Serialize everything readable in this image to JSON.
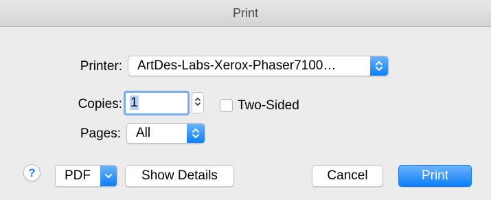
{
  "window": {
    "title": "Print"
  },
  "printer": {
    "label": "Printer:",
    "value": "ArtDes-Labs-Xerox-Phaser7100…"
  },
  "copies": {
    "label": "Copies:",
    "value": "1"
  },
  "two_sided": {
    "label": "Two-Sided",
    "checked": false
  },
  "pages": {
    "label": "Pages:",
    "value": "All"
  },
  "footer": {
    "help_label": "?",
    "pdf_label": "PDF",
    "show_details_label": "Show Details",
    "cancel_label": "Cancel",
    "print_label": "Print"
  },
  "colors": {
    "accent": "#0d7ffb",
    "focus_ring": "#79acf0",
    "background": "#ececec"
  }
}
